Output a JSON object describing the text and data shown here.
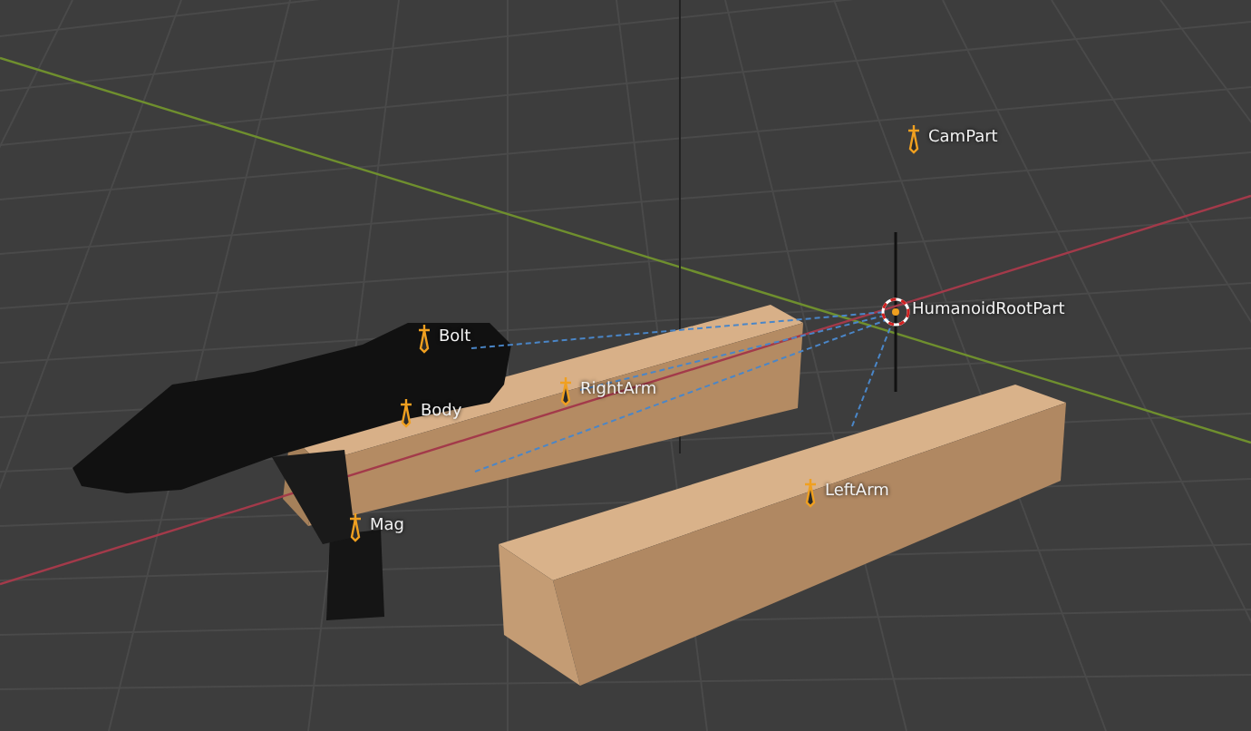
{
  "viewport": {
    "objects": [
      {
        "label": "CamPart",
        "kind": "bone"
      },
      {
        "label": "HumanoidRootPart",
        "kind": "cursor"
      },
      {
        "label": "Bolt",
        "kind": "bone"
      },
      {
        "label": "RightArm",
        "kind": "bone"
      },
      {
        "label": "Body",
        "kind": "bone"
      },
      {
        "label": "Mag",
        "kind": "bone"
      },
      {
        "label": "LeftArm",
        "kind": "bone"
      }
    ]
  }
}
